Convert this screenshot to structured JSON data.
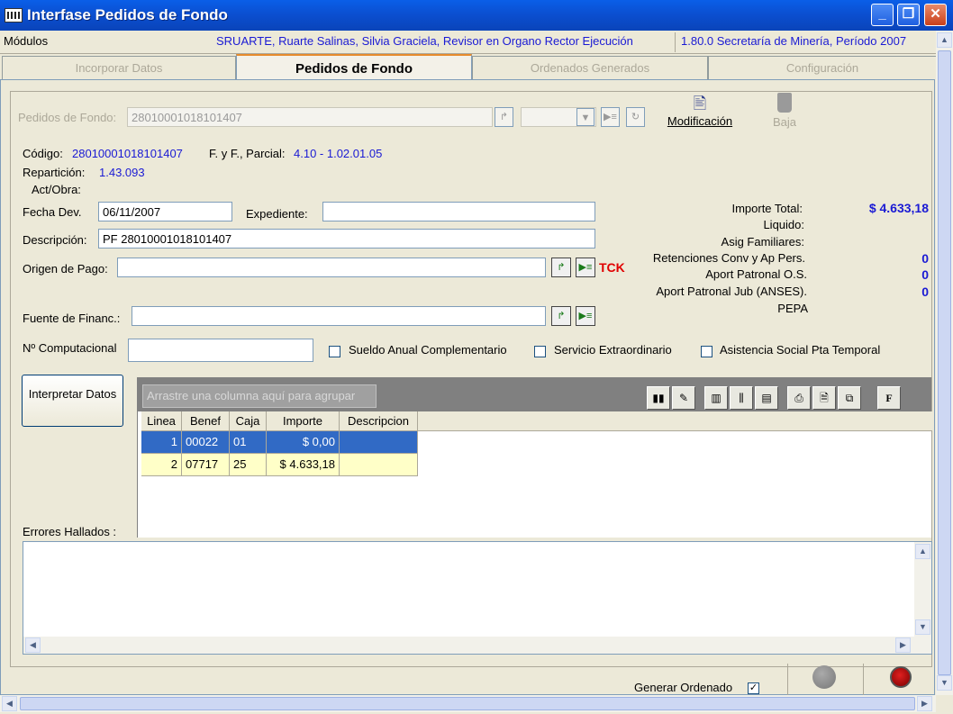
{
  "window": {
    "title": "Interfase Pedidos de Fondo",
    "buttons": {
      "minimize": "_",
      "maximize": "❐",
      "close": "✕"
    }
  },
  "modules_bar": {
    "label": "Módulos",
    "user": "SRUARTE, Ruarte Salinas, Silvia Graciela, Revisor en Organo Rector Ejecución",
    "version": "1.80.0 Secretaría de Minería, Período 2007"
  },
  "tabs": [
    {
      "label": "Incorporar Datos",
      "active": false
    },
    {
      "label": "Pedidos de Fondo",
      "active": true
    },
    {
      "label": "Ordenados Generados",
      "active": false
    },
    {
      "label": "Configuración",
      "active": false
    }
  ],
  "header": {
    "pedidos_label": "Pedidos de Fondo:",
    "pedidos_value": "28010001018101407",
    "modificacion_label": "Modificación",
    "baja_label": "Baja"
  },
  "info": {
    "codigo_label": "Código:",
    "codigo_value": "28010001018101407",
    "fyf_label": "F. y F., Parcial:",
    "fyf_value": "4.10 - 1.02.01.05",
    "reparticion_label": "Repartición:",
    "reparticion_value": "1.43.093",
    "actobra_label": "Act/Obra:"
  },
  "form": {
    "fecha_label": "Fecha Dev.",
    "fecha_value": "06/11/2007",
    "expediente_label": "Expediente:",
    "expediente_value": "",
    "descripcion_label": "Descripción:",
    "descripcion_value": "PF 28010001018101407",
    "origen_label": "Origen de Pago:",
    "origen_value": "",
    "tck_label": "TCK",
    "fuente_label": "Fuente de Financ.:",
    "fuente_value": "",
    "ncomp_label": "Nº Computacional",
    "ncomp_value": "",
    "checkboxes": [
      {
        "label": "Sueldo Anual Complementario",
        "checked": false
      },
      {
        "label": "Servicio Extraordinario",
        "checked": false
      },
      {
        "label": "Asistencia Social Pta Temporal",
        "checked": false
      }
    ]
  },
  "totals": {
    "importe_total_label": "Importe Total:",
    "importe_total_value": "$ 4.633,18",
    "liquido_label": "Liquido:",
    "asig_label": "Asig Familiares:",
    "retenciones_label": "Retenciones Conv y Ap Pers.",
    "retenciones_value": "0",
    "aport_os_label": "Aport Patronal O.S.",
    "aport_os_value": "0",
    "aport_jub_label": "Aport Patronal Jub (ANSES).",
    "aport_jub_value": "0",
    "pepa_label": "PEPA"
  },
  "interpretar_button": "Interpretar Datos",
  "grid": {
    "group_placeholder": "Arrastre una columna aquí para agrupar",
    "columns": [
      "Linea",
      "Benef",
      "Caja",
      "Importe",
      "Descripcion"
    ],
    "rows": [
      {
        "linea": "1",
        "benef": "00022",
        "caja": "01",
        "importe": "$ 0,00",
        "descripcion": "",
        "selected": true
      },
      {
        "linea": "2",
        "benef": "07717",
        "caja": "25",
        "importe": "$ 4.633,18",
        "descripcion": ""
      }
    ]
  },
  "errores_label": "Errores Hallados :",
  "generar_label": "Generar Ordenado",
  "generar_checked": "✓",
  "colors": {
    "title_blue": "#0A4FD1",
    "selection": "#316AC5",
    "highlight_row": "#FFFFC8",
    "value_blue": "#1a1ad4",
    "tck_red": "#e00000"
  }
}
